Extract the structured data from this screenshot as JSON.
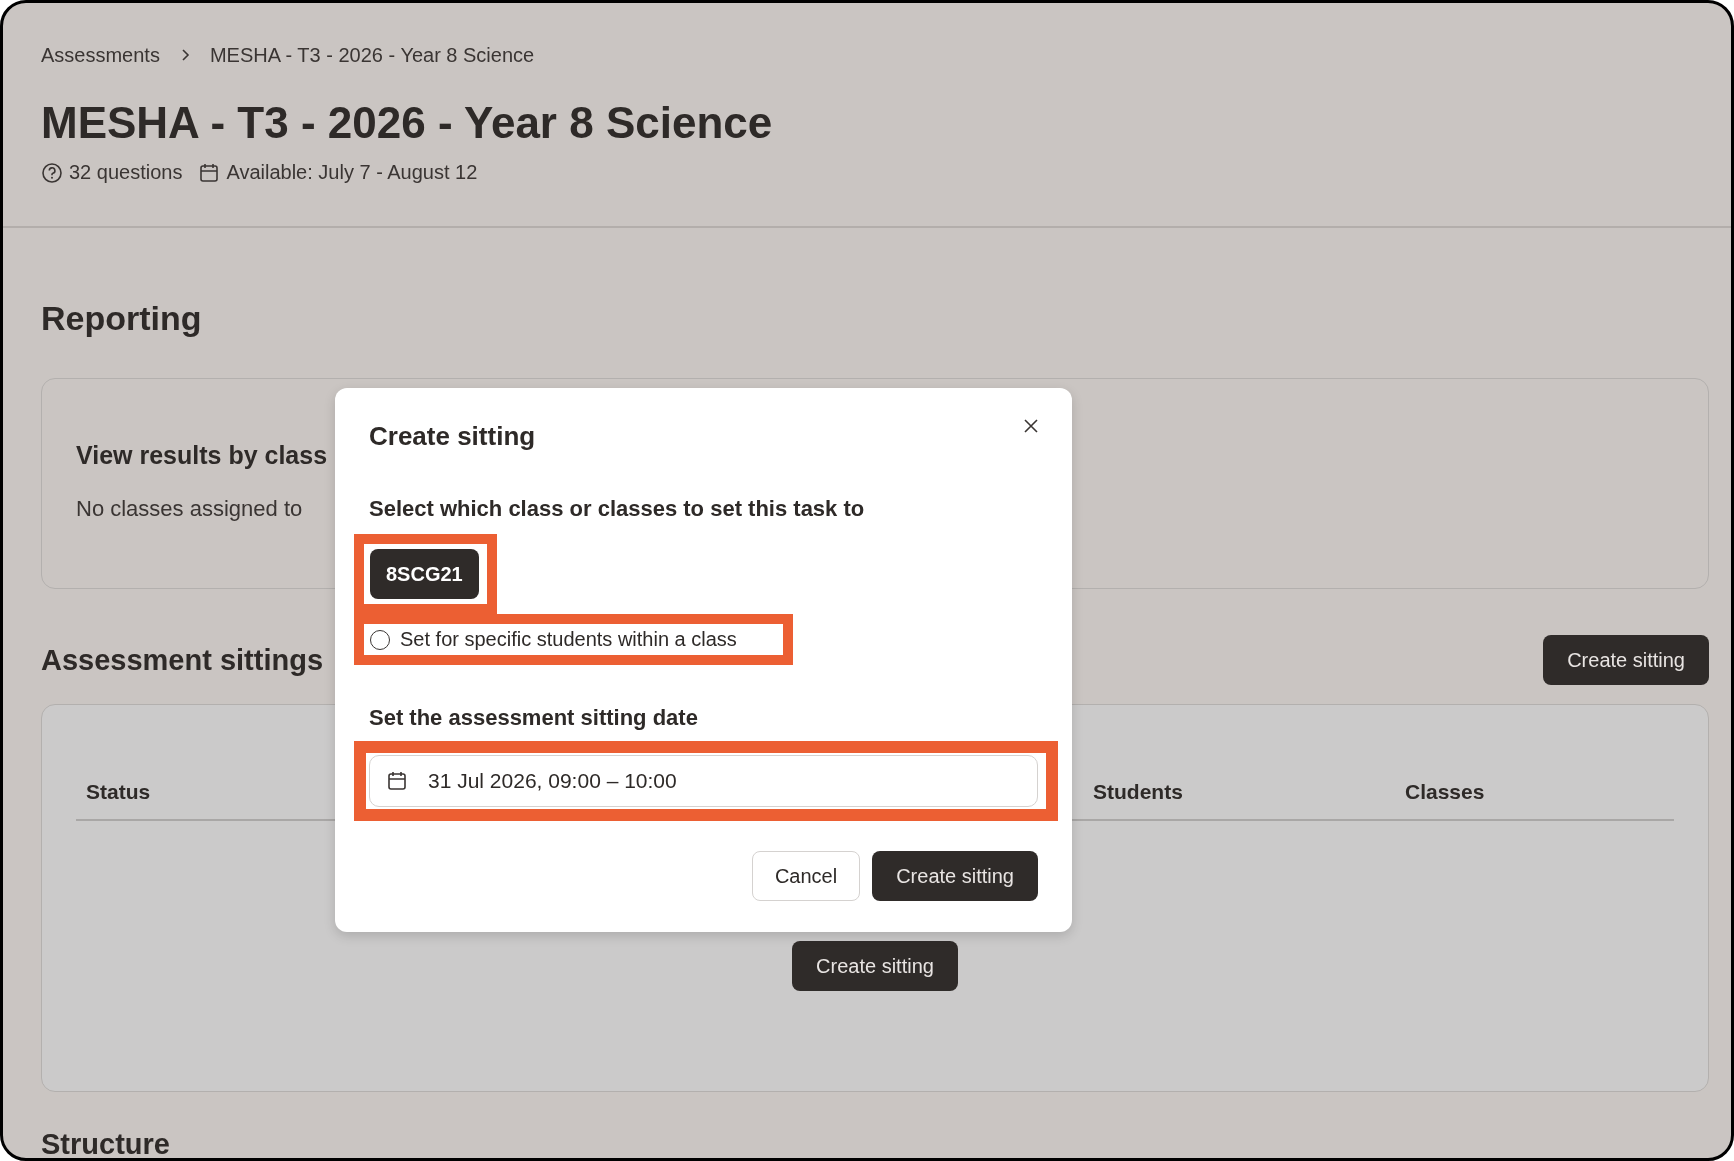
{
  "breadcrumb": [
    "Assessments",
    "MESHA - T3 - 2026 - Year 8 Science"
  ],
  "title": "MESHA - T3 - 2026 - Year 8 Science",
  "meta": {
    "questions": "32 questions",
    "available": "Available: July 7 - August 12"
  },
  "reporting": {
    "heading": "Reporting",
    "card_title": "View results by class",
    "card_text": "No classes assigned to"
  },
  "sittings": {
    "heading": "Assessment sittings",
    "create_button": "Create sitting",
    "columns": [
      "Status",
      "Students",
      "Classes"
    ],
    "empty_button": "Create sitting"
  },
  "structure_heading": "Structure",
  "dialog": {
    "title": "Create sitting",
    "class_label": "Select which class or classes to set this task to",
    "classes": [
      {
        "label": "8SCG21",
        "selected": true
      }
    ],
    "specific_students": {
      "label": "Set for specific students within a class",
      "checked": false
    },
    "date_label": "Set the assessment sitting date",
    "date_value": "31 Jul 2026, 09:00 – 10:00",
    "buttons": [
      {
        "label": "Cancel",
        "kind": "secondary"
      },
      {
        "label": "Create sitting",
        "kind": "primary"
      }
    ]
  }
}
